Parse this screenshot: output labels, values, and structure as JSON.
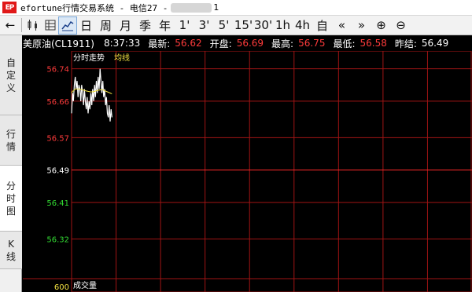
{
  "window": {
    "logo": "EP",
    "title": "efortune行情交易系统 - 电信27 - ",
    "title_tail": "1"
  },
  "toolbar": {
    "back_label": "←",
    "periods": [
      "日",
      "周",
      "月",
      "季",
      "年",
      "1'",
      "3'",
      "5'",
      "15'",
      "30'",
      "1h",
      "4h",
      "自"
    ],
    "nav": [
      "«",
      "»"
    ],
    "zoom_in": "⊕",
    "zoom_out": "⊖"
  },
  "sidebar": {
    "tabs": [
      {
        "label": "自定义",
        "chars": [
          "自",
          "定",
          "义"
        ]
      },
      {
        "label": "行情",
        "chars": [
          "行",
          "情"
        ]
      },
      {
        "label": "分时图",
        "chars": [
          "分",
          "时",
          "图"
        ]
      },
      {
        "label": "K线",
        "chars": [
          "K",
          "线"
        ]
      }
    ]
  },
  "quote": {
    "symbol": "美原油(CL1911)",
    "time": "8:37:33",
    "latest_label": "最新:",
    "latest": "56.62",
    "open_label": "开盘:",
    "open": "56.69",
    "high_label": "最高:",
    "high": "56.75",
    "low_label": "最低:",
    "low": "56.58",
    "prev_label": "昨结:",
    "prev": "56.49"
  },
  "chart": {
    "title": "分时走势",
    "avg_label": "均线",
    "volume_label": "成交量",
    "volume_tick": "600",
    "colors": {
      "grid": "#a01414",
      "prev_line": "#ff2a2a",
      "price": "#ffffff",
      "avg": "#f0e040",
      "up": "#ff3b3b",
      "down": "#33dd33",
      "flat": "#ffffff"
    }
  },
  "chart_data": {
    "type": "line",
    "title": "分时走势",
    "y_ticks": [
      {
        "value": "56.74",
        "color": "up"
      },
      {
        "value": "56.66",
        "color": "up"
      },
      {
        "value": "56.57",
        "color": "up"
      },
      {
        "value": "56.49",
        "color": "flat"
      },
      {
        "value": "56.41",
        "color": "down"
      },
      {
        "value": "56.32",
        "color": "down"
      }
    ],
    "ylim": [
      56.28,
      56.745
    ],
    "prev_settle": 56.49,
    "series": [
      {
        "name": "分时走势",
        "values": [
          56.63,
          56.68,
          56.66,
          56.7,
          56.72,
          56.69,
          56.71,
          56.67,
          56.7,
          56.69,
          56.66,
          56.7,
          56.68,
          56.65,
          56.69,
          56.66,
          56.64,
          56.67,
          56.63,
          56.66,
          56.64,
          56.68,
          56.65,
          56.69,
          56.66,
          56.7,
          56.67,
          56.71,
          56.68,
          56.72,
          56.69,
          56.74,
          56.71,
          56.68,
          56.71,
          56.67,
          56.69,
          56.65,
          56.67,
          56.63,
          56.62,
          56.65,
          56.61,
          56.64,
          56.62
        ]
      },
      {
        "name": "均线",
        "values": [
          56.68,
          56.685,
          56.685,
          56.688,
          56.69,
          56.69,
          56.69,
          56.69,
          56.69,
          56.69,
          56.689,
          56.689,
          56.688,
          56.687,
          56.687,
          56.686,
          56.685,
          56.685,
          56.684,
          56.684,
          56.683,
          56.683,
          56.683,
          56.683,
          56.684,
          56.684,
          56.685,
          56.686,
          56.686,
          56.687,
          56.687,
          56.688,
          56.688,
          56.688,
          56.688,
          56.687,
          56.686,
          56.685,
          56.684,
          56.683,
          56.682,
          56.681,
          56.68,
          56.679,
          56.678
        ]
      }
    ],
    "total_points": 240
  }
}
